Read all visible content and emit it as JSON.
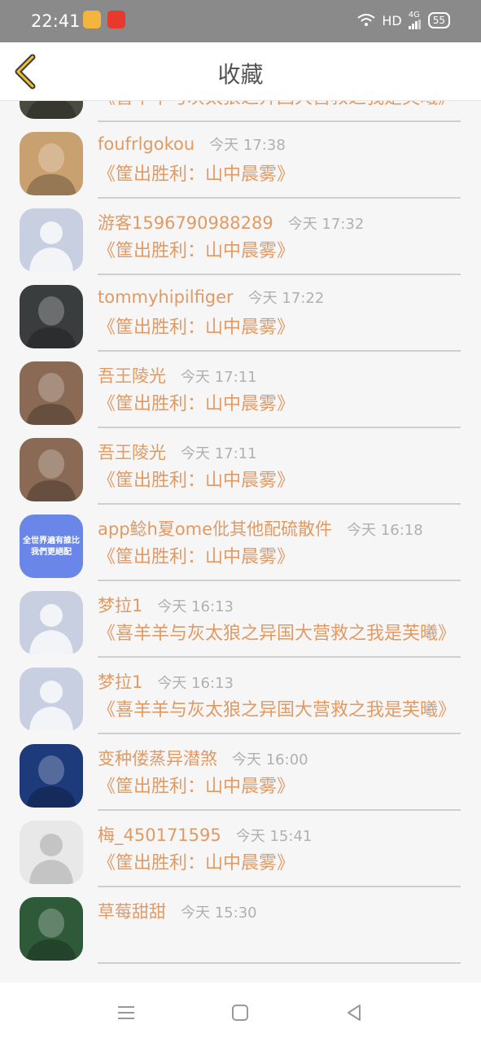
{
  "status_bar": {
    "time": "22:41",
    "network": "HD",
    "signal": "4G",
    "battery": "55",
    "icons": [
      "weibo-icon",
      "app-icon",
      "wifi-icon",
      "signal-icon",
      "battery-icon"
    ]
  },
  "nav": {
    "title": "收藏",
    "back_icon": "chevron-left-icon"
  },
  "list": {
    "items": [
      {
        "name": "",
        "time": "",
        "work": "《喜羊羊与灰太狼之异国大营救之我是芙曦》",
        "avatar": "soldier-photo",
        "avatar_color": "#4a4a40"
      },
      {
        "name": "foufrlgokou",
        "time": "今天 17:38",
        "work": "《筐出胜利：山中晨雾》",
        "avatar": "girl-photo",
        "avatar_color": "#c9a070"
      },
      {
        "name": "游客1596790988289",
        "time": "今天 17:32",
        "work": "《筐出胜利：山中晨雾》",
        "avatar": "default-avatar",
        "avatar_color": "#c8cfe0"
      },
      {
        "name": "tommyhipilfiger",
        "time": "今天 17:22",
        "work": "《筐出胜利：山中晨雾》",
        "avatar": "soldier-photo",
        "avatar_color": "#3a3d3e"
      },
      {
        "name": "吾王陵光",
        "time": "今天 17:11",
        "work": "《筐出胜利：山中晨雾》",
        "avatar": "costume-photo",
        "avatar_color": "#8a6a55"
      },
      {
        "name": "吾王陵光",
        "time": "今天 17:11",
        "work": "《筐出胜利：山中晨雾》",
        "avatar": "costume-photo",
        "avatar_color": "#8a6a55"
      },
      {
        "name": "app鲶h夏ome仳其他配硫散件",
        "time": "今天 16:18",
        "work": "《筐出胜利：山中晨雾》",
        "avatar": "text-badge",
        "avatar_color": "#6a86e8",
        "avatar_text": "全世界遍有誰比我們更絕配"
      },
      {
        "name": "梦拉1",
        "time": "今天 16:13",
        "work": "《喜羊羊与灰太狼之异国大营救之我是芙曦》",
        "avatar": "default-avatar",
        "avatar_color": "#c8cfe0"
      },
      {
        "name": "梦拉1",
        "time": "今天 16:13",
        "work": "《喜羊羊与灰太狼之异国大营救之我是芙曦》",
        "avatar": "default-avatar",
        "avatar_color": "#c8cfe0"
      },
      {
        "name": "变种偻蒸异潜煞",
        "time": "今天 16:00",
        "work": "《筐出胜利：山中晨雾》",
        "avatar": "cartoon-photo",
        "avatar_color": "#1d3a7a"
      },
      {
        "name": "梅_450171595",
        "time": "今天 15:41",
        "work": "《筐出胜利：山中晨雾》",
        "avatar": "grey-default-avatar",
        "avatar_color": "#e8e8e8"
      },
      {
        "name": "草莓甜甜",
        "time": "今天 15:30",
        "work": "",
        "avatar": "cartoon-photo",
        "avatar_color": "#2f5a3a"
      }
    ]
  },
  "bottom_nav": {
    "icons": [
      "menu-icon",
      "home-icon",
      "back-icon"
    ]
  }
}
